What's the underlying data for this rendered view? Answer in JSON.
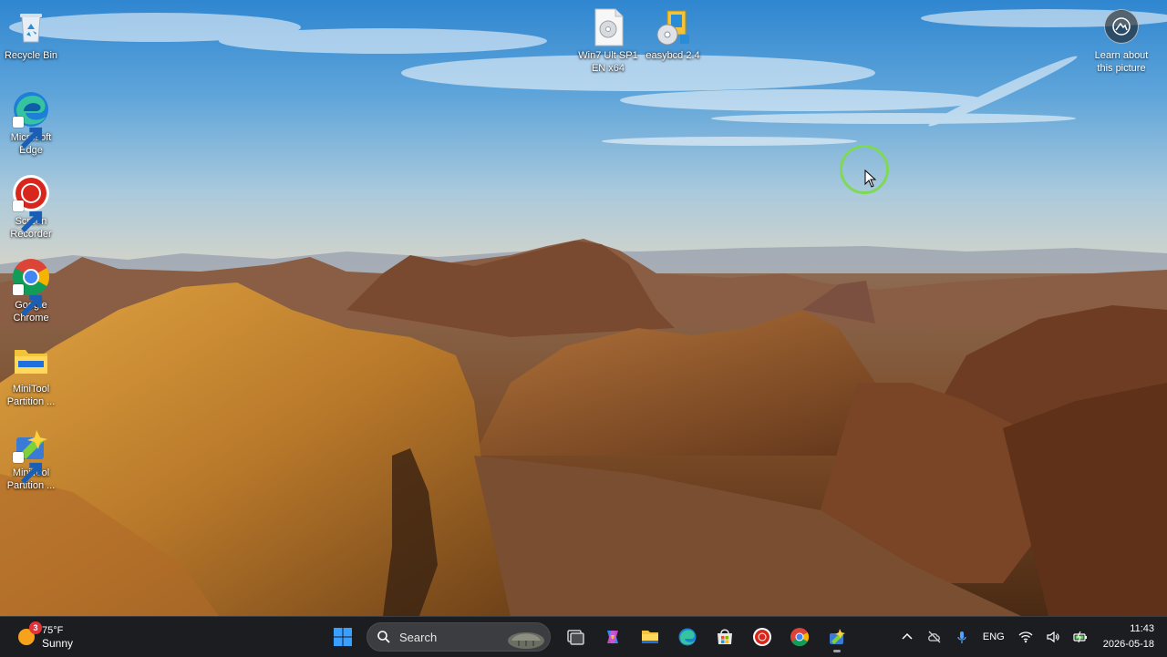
{
  "desktop": {
    "left_icons": [
      {
        "label": "Recycle Bin"
      },
      {
        "label": "Microsoft\nEdge"
      },
      {
        "label": "Screen\nRecorder"
      },
      {
        "label": "Google\nChrome"
      },
      {
        "label": "MiniTool\nPartition ..."
      },
      {
        "label": "MiniTool\nPartition ..."
      }
    ],
    "top_icons": [
      {
        "label": "Win7 Ult SP1\nEN x64"
      },
      {
        "label": "easybcd 2.4"
      }
    ],
    "learn_about": {
      "label": "Learn about\nthis picture"
    }
  },
  "taskbar": {
    "weather": {
      "badge": "3",
      "temp": "75°F",
      "condition": "Sunny"
    },
    "search": {
      "placeholder": "Search"
    },
    "tray": {
      "language": "ENG"
    },
    "clock": {
      "time": "11:43",
      "date": "2026-05-18"
    }
  },
  "colors": {
    "cursor_ring": "#7ed957",
    "taskbar_bg": "#1c1e22",
    "sky_top": "#3a8fd4",
    "desert": "#b06a2a"
  }
}
